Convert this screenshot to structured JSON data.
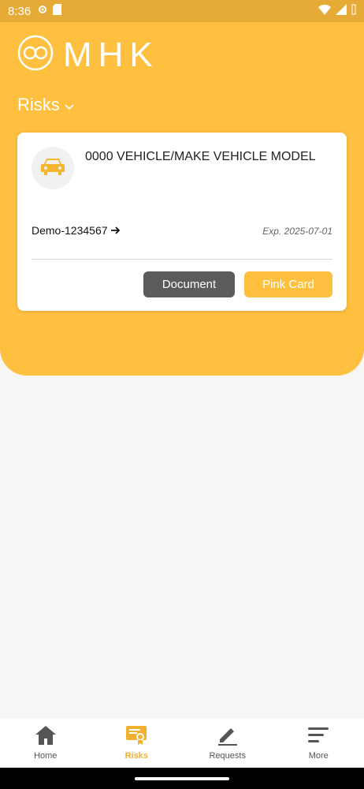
{
  "status": {
    "time": "8:36"
  },
  "brand": {
    "logo_text": "MHK"
  },
  "section": {
    "title": "Risks"
  },
  "card": {
    "vehicle_title": "0000 VEHICLE/MAKE VEHICLE MODEL",
    "policy_number": "Demo-1234567",
    "expiry": "Exp. 2025-07-01",
    "document_label": "Document",
    "pink_card_label": "Pink Card"
  },
  "nav": {
    "items": [
      {
        "label": "Home",
        "icon": "home-icon"
      },
      {
        "label": "Risks",
        "icon": "certificate-icon",
        "active": true
      },
      {
        "label": "Requests",
        "icon": "pen-icon"
      },
      {
        "label": "More",
        "icon": "menu-icon"
      }
    ]
  },
  "colors": {
    "brand": "#ffc040",
    "nav_active": "#f0b030",
    "button_dark": "#5b5b5b"
  }
}
